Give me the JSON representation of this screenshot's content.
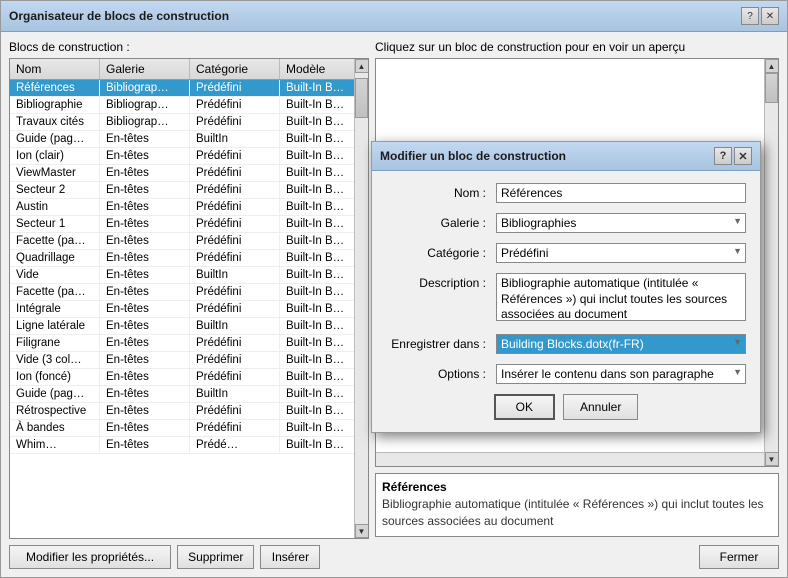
{
  "mainDialog": {
    "title": "Organisateur de blocs de construction",
    "helpBtn": "?",
    "closeBtn": "✕"
  },
  "leftPanel": {
    "title": "Blocs de construction :",
    "columns": [
      "Nom",
      "Galerie",
      "Catégorie",
      "Modèle"
    ],
    "rows": [
      {
        "nom": "Références",
        "galerie": "Bibliograp…",
        "categorie": "Prédéfini",
        "modele": "Built-In B…"
      },
      {
        "nom": "Bibliographie",
        "galerie": "Bibliograp…",
        "categorie": "Prédéfini",
        "modele": "Built-In B…"
      },
      {
        "nom": "Travaux cités",
        "galerie": "Bibliograp…",
        "categorie": "Prédéfini",
        "modele": "Built-In B…"
      },
      {
        "nom": "Guide (pag…",
        "galerie": "En-têtes",
        "categorie": "BuiltIn",
        "modele": "Built-In B…"
      },
      {
        "nom": "Ion (clair)",
        "galerie": "En-têtes",
        "categorie": "Prédéfini",
        "modele": "Built-In B…"
      },
      {
        "nom": "ViewMaster",
        "galerie": "En-têtes",
        "categorie": "Prédéfini",
        "modele": "Built-In B…"
      },
      {
        "nom": "Secteur 2",
        "galerie": "En-têtes",
        "categorie": "Prédéfini",
        "modele": "Built-In B…"
      },
      {
        "nom": "Austin",
        "galerie": "En-têtes",
        "categorie": "Prédéfini",
        "modele": "Built-In B…"
      },
      {
        "nom": "Secteur 1",
        "galerie": "En-têtes",
        "categorie": "Prédéfini",
        "modele": "Built-In B…"
      },
      {
        "nom": "Facette (pa…",
        "galerie": "En-têtes",
        "categorie": "Prédéfini",
        "modele": "Built-In B…"
      },
      {
        "nom": "Quadrillage",
        "galerie": "En-têtes",
        "categorie": "Prédéfini",
        "modele": "Built-In B…"
      },
      {
        "nom": "Vide",
        "galerie": "En-têtes",
        "categorie": "BuiltIn",
        "modele": "Built-In B…"
      },
      {
        "nom": "Facette (pa…",
        "galerie": "En-têtes",
        "categorie": "Prédéfini",
        "modele": "Built-In B…"
      },
      {
        "nom": "Intégrale",
        "galerie": "En-têtes",
        "categorie": "Prédéfini",
        "modele": "Built-In B…"
      },
      {
        "nom": "Ligne latérale",
        "galerie": "En-têtes",
        "categorie": "BuiltIn",
        "modele": "Built-In B…"
      },
      {
        "nom": "Filigrane",
        "galerie": "En-têtes",
        "categorie": "Prédéfini",
        "modele": "Built-In B…"
      },
      {
        "nom": "Vide (3 col…",
        "galerie": "En-têtes",
        "categorie": "Prédéfini",
        "modele": "Built-In B…"
      },
      {
        "nom": "Ion (foncé)",
        "galerie": "En-têtes",
        "categorie": "Prédéfini",
        "modele": "Built-In B…"
      },
      {
        "nom": "Guide (pag…",
        "galerie": "En-têtes",
        "categorie": "BuiltIn",
        "modele": "Built-In B…"
      },
      {
        "nom": "Rétrospective",
        "galerie": "En-têtes",
        "categorie": "Prédéfini",
        "modele": "Built-In B…"
      },
      {
        "nom": "À bandes",
        "galerie": "En-têtes",
        "categorie": "Prédéfini",
        "modele": "Built-In B…"
      },
      {
        "nom": "Whim…",
        "galerie": "En-têtes",
        "categorie": "Prédé…",
        "modele": "Built-In B…"
      }
    ],
    "selectedRow": 0
  },
  "buttons": {
    "modifyLabel": "Modifier les propriétés...",
    "deleteLabel": "Supprimer",
    "insertLabel": "Insérer"
  },
  "rightPanel": {
    "previewLabel": "Cliquez sur un bloc de construction pour en voir un aperçu",
    "infoTitle": "Références",
    "infoDesc": "Bibliographie automatique (intitulée « Références ») qui inclut toutes les sources associées au document"
  },
  "closeBtn": {
    "label": "Fermer"
  },
  "subDialog": {
    "title": "Modifier un bloc de construction",
    "helpBtn": "?",
    "closeBtn": "✕",
    "fields": {
      "nom": {
        "label": "Nom :",
        "value": "Références"
      },
      "galerie": {
        "label": "Galerie :",
        "value": "Bibliographies",
        "options": [
          "Bibliographies"
        ]
      },
      "categorie": {
        "label": "Catégorie :",
        "value": "Prédéfini",
        "options": [
          "Prédéfini"
        ]
      },
      "description": {
        "label": "Description :",
        "value": "Bibliographie automatique (intitulée « Références ») qui inclut toutes les sources associées au document"
      },
      "enregistrerDans": {
        "label": "Enregistrer dans :",
        "value": "Building Blocks.dotx(fr-FR)",
        "options": [
          "Building Blocks.dotx(fr-FR)"
        ]
      },
      "options": {
        "label": "Options :",
        "value": "Insérer le contenu dans son paragraphe",
        "options": [
          "Insérer le contenu dans son paragraphe"
        ]
      }
    },
    "okLabel": "OK",
    "cancelLabel": "Annuler"
  }
}
